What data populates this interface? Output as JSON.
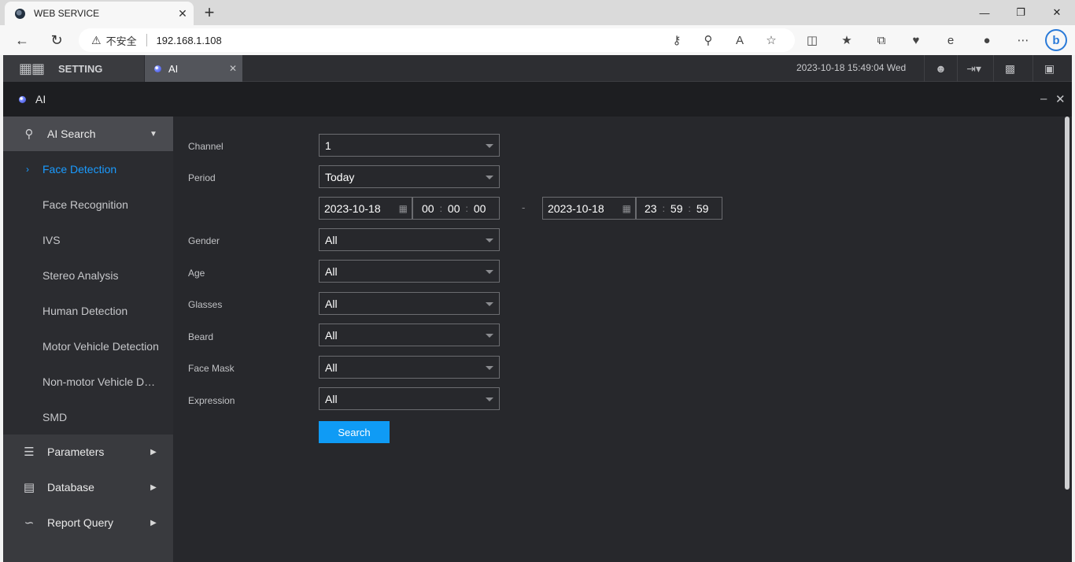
{
  "browser": {
    "tab_title": "WEB SERVICE",
    "tab_close": "✕",
    "new_tab": "+",
    "security_label": "不安全",
    "url": "192.168.1.108"
  },
  "app": {
    "setting_label": "SETTING",
    "tab_label": "AI",
    "tab_close": "✕",
    "datetime": "2023-10-18 15:49:04 Wed",
    "header_title": "AI",
    "minimize": "–",
    "close": "✕"
  },
  "sidebar": {
    "ai_search": "AI Search",
    "items": [
      "Face Detection",
      "Face Recognition",
      "IVS",
      "Stereo Analysis",
      "Human Detection",
      "Motor Vehicle Detection",
      "Non-motor Vehicle Detection",
      "SMD"
    ],
    "parameters": "Parameters",
    "database": "Database",
    "report_query": "Report Query"
  },
  "form": {
    "channel_label": "Channel",
    "channel_value": "1",
    "period_label": "Period",
    "period_value": "Today",
    "start_date": "2023-10-18",
    "start_h": "00",
    "start_m": "00",
    "start_s": "00",
    "range_sep": "-",
    "end_date": "2023-10-18",
    "end_h": "23",
    "end_m": "59",
    "end_s": "59",
    "time_sep": ":",
    "gender_label": "Gender",
    "gender_value": "All",
    "age_label": "Age",
    "age_value": "All",
    "glasses_label": "Glasses",
    "glasses_value": "All",
    "beard_label": "Beard",
    "beard_value": "All",
    "facemask_label": "Face Mask",
    "facemask_value": "All",
    "expression_label": "Expression",
    "expression_value": "All",
    "search_button": "Search"
  }
}
